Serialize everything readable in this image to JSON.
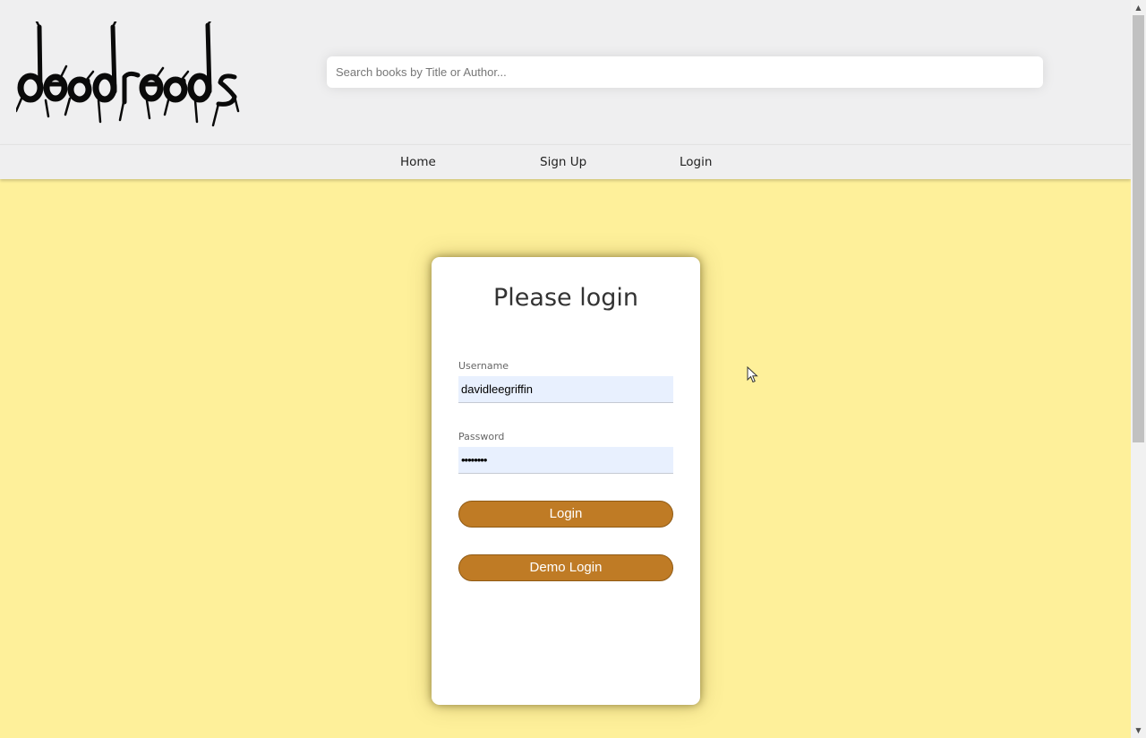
{
  "header": {
    "logo_text": "deadreads",
    "search": {
      "placeholder": "Search books by Title or Author...",
      "value": ""
    }
  },
  "nav": {
    "items": [
      {
        "label": "Home"
      },
      {
        "label": "Sign Up"
      },
      {
        "label": "Login"
      }
    ]
  },
  "login_form": {
    "title": "Please login",
    "username": {
      "label": "Username",
      "value": "davidleegriffin"
    },
    "password": {
      "label": "Password",
      "value": "••••••••"
    },
    "login_button": "Login",
    "demo_button": "Demo Login"
  },
  "colors": {
    "page_background": "#fef09a",
    "header_background": "#efeff0",
    "button": "#bf7b25",
    "input_background": "#e8f0fe"
  },
  "icons": {
    "cursor": "mouse-pointer-icon",
    "scroll_up": "arrow-up-icon",
    "scroll_down": "arrow-down-icon"
  }
}
